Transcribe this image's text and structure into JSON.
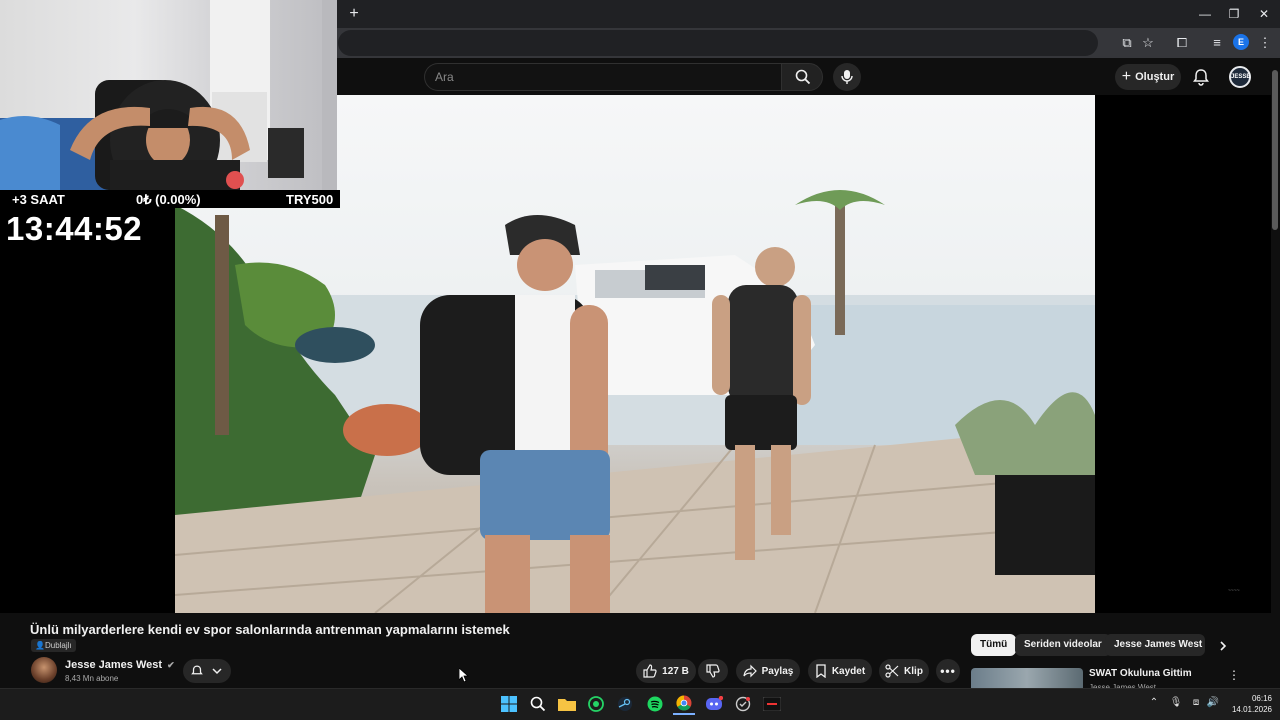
{
  "browser": {
    "new_tab_symbol": "+",
    "window_controls": [
      "minimize",
      "restore",
      "close"
    ],
    "profile_initial": "E"
  },
  "youtube": {
    "search_placeholder": "Ara",
    "create_label": "Oluştur",
    "avatar_text": "JESSE"
  },
  "stream_overlay": {
    "extra_time": "+3 SAAT",
    "donation": "0₺ (0.00%)",
    "goal": "TRY500",
    "timer": "13:44:52"
  },
  "video": {
    "title": "Ünlü milyarderlere kendi ev spor salonlarında antrenman yapmalarını istemek",
    "dub_badge": "Dublajlı",
    "channel_name": "Jesse James West",
    "subscribers": "8,43 Mn abone",
    "likes": "127 B",
    "share_label": "Paylaş",
    "save_label": "Kaydet",
    "clip_label": "Klip"
  },
  "recommendations": {
    "chips": [
      "Tümü",
      "Seriden videolar",
      "Jesse James West ad"
    ],
    "first_title": "SWAT Okuluna Gittim",
    "first_channel": "Jesse James West"
  },
  "taskbar": {
    "time": "06:16",
    "date": "14.01.2026",
    "apps": [
      "windows-start",
      "search",
      "file-explorer",
      "whatsapp",
      "steam",
      "spotify",
      "chrome",
      "discord",
      "app",
      "app"
    ]
  },
  "colors": {
    "bg": "#0f0f0f",
    "chip_active": "#f1f1f1",
    "taskbar": "#1c1c1c"
  }
}
